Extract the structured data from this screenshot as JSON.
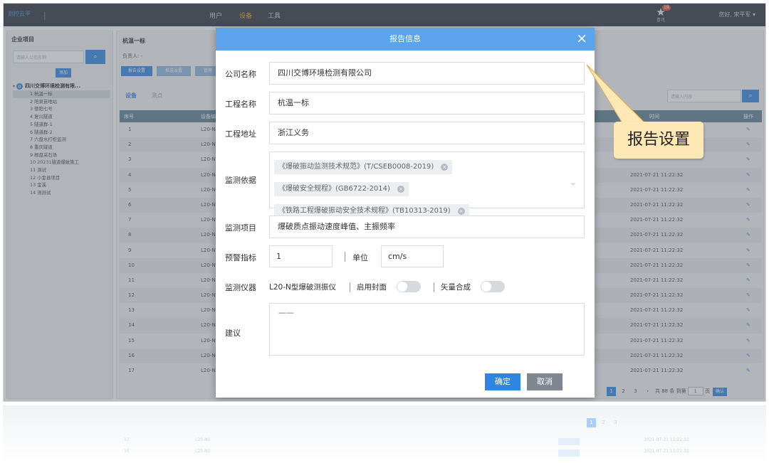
{
  "topbar": {
    "logo_text": "测控云平",
    "nav": [
      "用户",
      "设备",
      "工具"
    ],
    "nav_active_index": 1,
    "star_badge": "18",
    "star_label": "喜讯",
    "user": "您好, 宋平军 ▾"
  },
  "left_panel": {
    "title": "企业项目",
    "search_placeholder": "请输入公司名称",
    "add_label": "添加",
    "root_label": "四川交博环境检测有限...",
    "items": [
      "1 杭温一标",
      "2 阳泉苗地站",
      "3 德阳七号",
      "4 复兴隧道",
      "5 隧道群-1",
      "6 隧道群-2",
      "7 六盘水打桩监测",
      "8 重庆隧道",
      "9 根盘采石场",
      "10 20231隧道爆破施工",
      "11 测试",
      "12 小金县项目",
      "13 金溪",
      "14 测测试"
    ],
    "selected_index": 0
  },
  "main": {
    "title": "杭温一标",
    "sub": "负责人: -",
    "buttons": [
      "报告设置",
      "推送设置",
      "管理"
    ],
    "tabs": [
      "设备",
      "测点"
    ],
    "active_tab": 0,
    "search_placeholder": "请输入内容",
    "headers": [
      "序号",
      "设备编号",
      "时间",
      "操作"
    ],
    "rows": [
      {
        "no": "1",
        "dev": "L20-N2",
        "time": ""
      },
      {
        "no": "2",
        "dev": "L20-N2",
        "time": ""
      },
      {
        "no": "3",
        "dev": "L20-N2",
        "time": ""
      },
      {
        "no": "4",
        "dev": "L20-N2",
        "time": "2021-07-21 11:22:32"
      },
      {
        "no": "5",
        "dev": "L20-N2",
        "time": "2021-07-21 11:22:32"
      },
      {
        "no": "6",
        "dev": "L20-N2",
        "time": "2021-07-21 11:22:32"
      },
      {
        "no": "7",
        "dev": "L20-N2",
        "time": "2021-07-21 11:22:32"
      },
      {
        "no": "8",
        "dev": "L20-N2",
        "time": "2021-07-21 11:22:32"
      },
      {
        "no": "9",
        "dev": "L20-N2",
        "time": "2021-07-21 11:22:32"
      },
      {
        "no": "10",
        "dev": "L20-N2",
        "time": "2021-07-21 11:22:32"
      },
      {
        "no": "11",
        "dev": "L20-N2",
        "time": "2021-07-21 11:22:32"
      },
      {
        "no": "12",
        "dev": "L20-N2",
        "time": "2021-07-21 11:22:32"
      },
      {
        "no": "13",
        "dev": "L20-N2",
        "time": "2021-07-21 11:22:32"
      },
      {
        "no": "14",
        "dev": "L20-N2",
        "time": "2021-07-21 11:22:32"
      },
      {
        "no": "15",
        "dev": "L20-N2",
        "time": "2021-07-21 11:22:32"
      },
      {
        "no": "16",
        "dev": "L20-N2",
        "time": "2021-07-21 11:22:32"
      },
      {
        "no": "17",
        "dev": "L20-N2",
        "time": "2021-07-21 11:22:32"
      }
    ],
    "edit_icon": "✎",
    "pager": {
      "pages": [
        "1",
        "2",
        "3"
      ],
      "active": 0,
      "next": "›",
      "total": "共 88 条",
      "goto": "到第",
      "page_input": "1",
      "page_unit": "页",
      "confirm": "确认"
    }
  },
  "modal": {
    "title": "报告信息",
    "close_icon": "×",
    "company_label": "公司名称",
    "company_value": "四川交博环境检测有限公司",
    "project_label": "工程名称",
    "project_value": "杭温一标",
    "address_label": "工程地址",
    "address_value": "浙江义务",
    "basis_label": "监测依据",
    "basis_tags": [
      "《爆破振动监测技术规范》(T/CSEB0008-2019)",
      "《爆破安全规程》(GB6722-2014)",
      "《铁路工程爆破振动安全技术规程》(TB10313-2019)"
    ],
    "items_label": "监测项目",
    "items_value": "爆破质点振动速度峰值、主振频率",
    "warn_label": "预警指标",
    "warn_value": "1",
    "unit_label": "单位",
    "unit_value": "cm/s",
    "instrument_label": "监测仪器",
    "instrument_value": "L20-N型爆破测振仪",
    "cover_label": "启用封面",
    "vector_label": "矢量合成",
    "advice_label": "建议",
    "advice_value": "——",
    "ok_label": "确定",
    "cancel_label": "取消"
  },
  "callout": {
    "text": "报告设置"
  },
  "colors": {
    "topbar": "#2d3440",
    "accent": "#2f86e2",
    "modal_header": "#5ba3ea",
    "callout_bg": "#fde8b6"
  }
}
